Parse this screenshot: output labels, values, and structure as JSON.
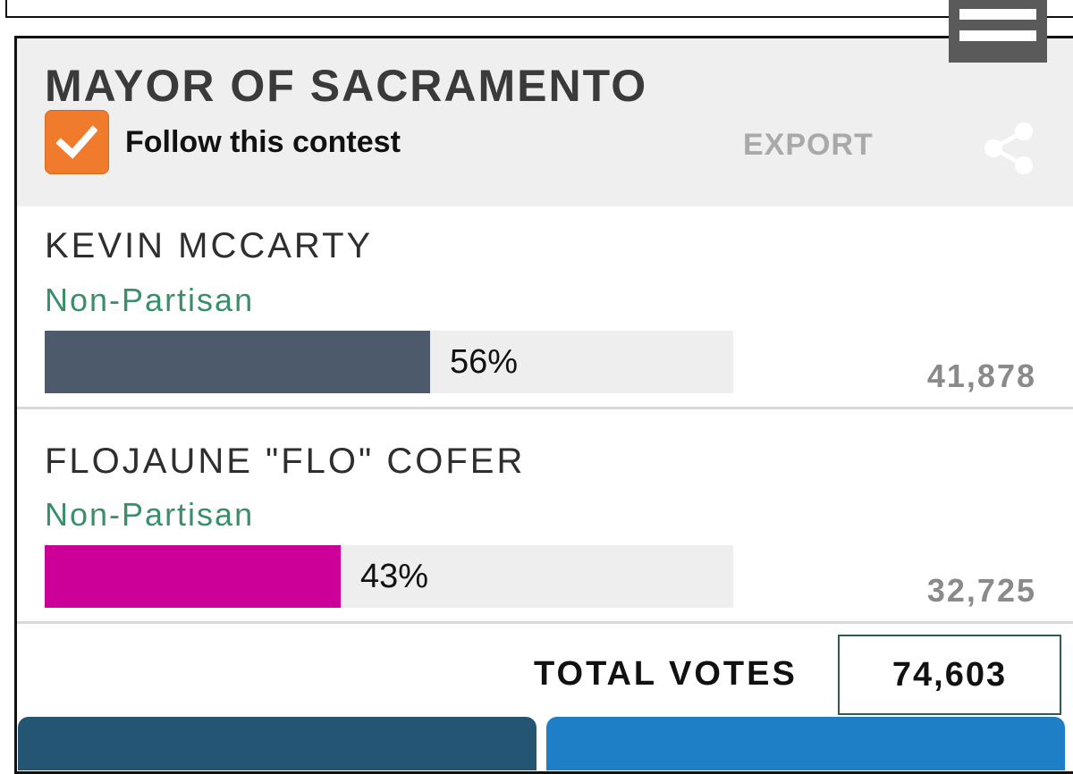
{
  "contest": {
    "title": "MAYOR OF SACRAMENTO",
    "follow_label": "Follow this contest",
    "follow_checked": true,
    "export_label": "EXPORT"
  },
  "candidates": [
    {
      "name": "KEVIN MCCARTY",
      "party": "Non-Partisan",
      "percent_label": "56%",
      "percent": 56,
      "votes": "41,878",
      "color": "#4d5a6b"
    },
    {
      "name": "FLOJAUNE \"FLO\" COFER",
      "party": "Non-Partisan",
      "percent_label": "43%",
      "percent": 43,
      "votes": "32,725",
      "color": "#cc0099"
    }
  ],
  "totals": {
    "label": "TOTAL VOTES",
    "value": "74,603"
  },
  "colors": {
    "accent_orange": "#f07b2c",
    "party_green": "#3a8f6b",
    "header_bg": "#efefef",
    "button_dark": "#245673",
    "button_blue": "#1f7fc6"
  },
  "icons": [
    "checkmark-icon",
    "share-icon",
    "menu-icon"
  ]
}
